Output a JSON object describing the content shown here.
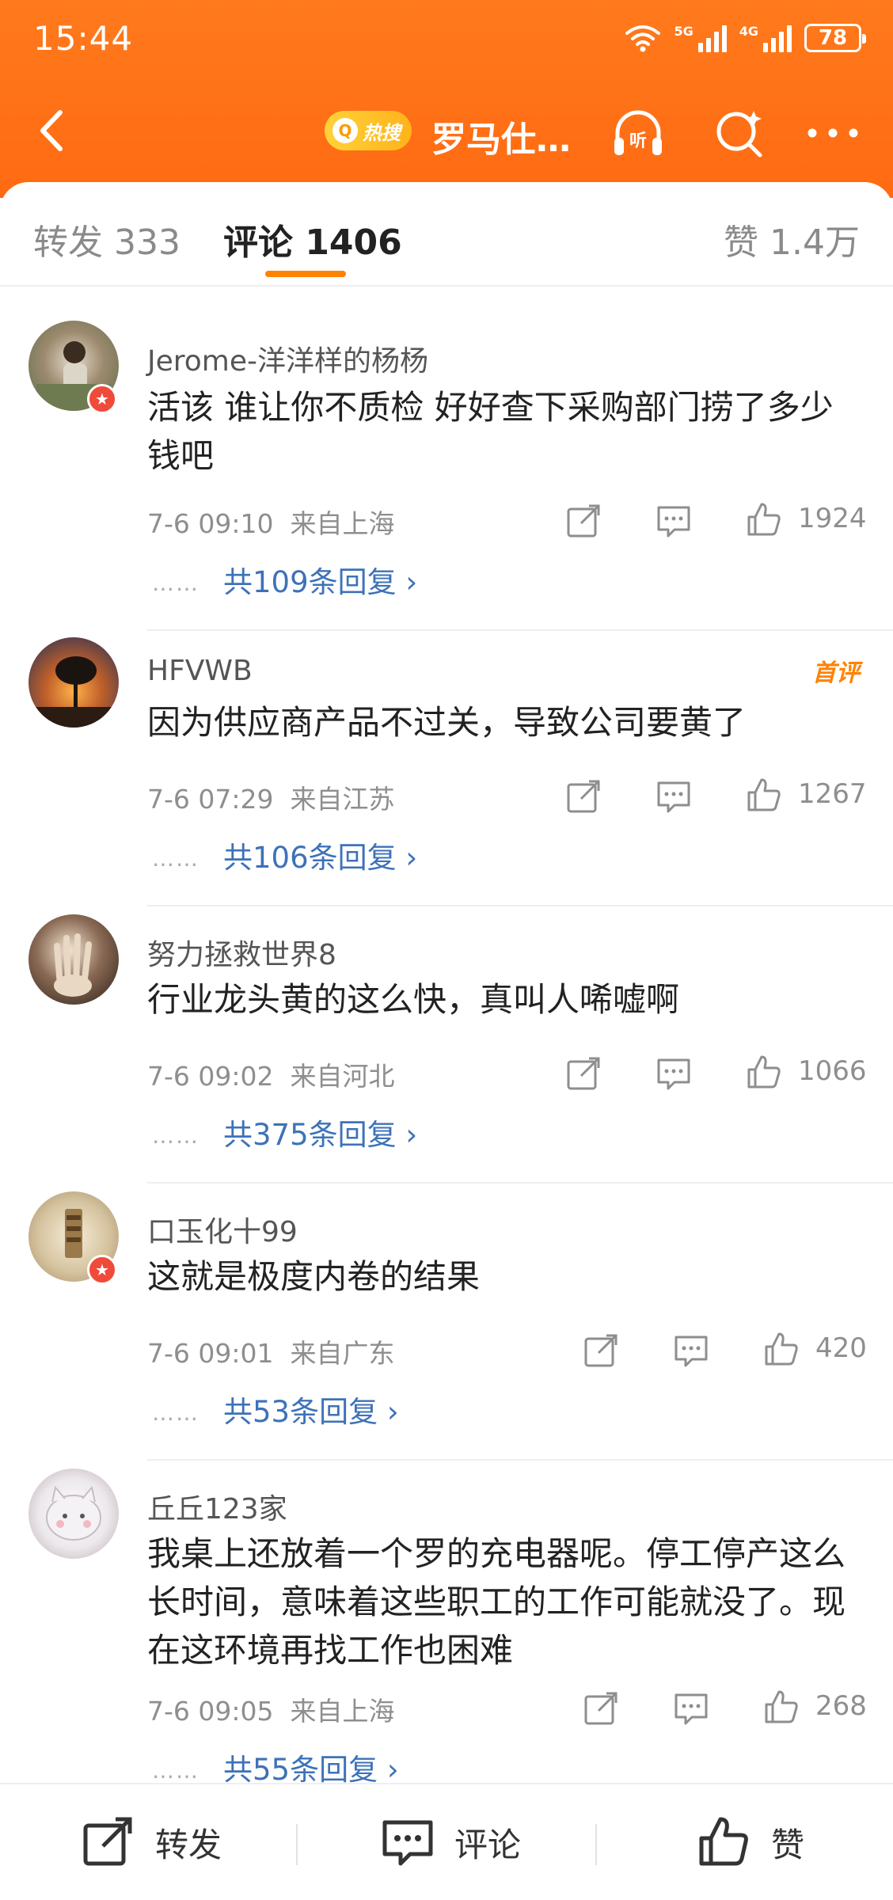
{
  "status_bar": {
    "time": "15:44",
    "net1": "5G",
    "net2": "4G",
    "battery": "78"
  },
  "nav": {
    "hot_label": "热搜",
    "title": "罗马仕…"
  },
  "tabs": {
    "repost": "转发 333",
    "comments": "评论 1406",
    "likes": "赞 1.4万"
  },
  "comments": [
    {
      "user": "Jerome-洋洋样的杨杨",
      "text": "活该 谁让你不质检 好好查下采购部门捞了多少钱吧",
      "time": "7-6 09:10",
      "location": "来自上海",
      "likes": "1924",
      "replies": "共109条回复",
      "dots": "……"
    },
    {
      "user": "HFVWB",
      "badge": "首评",
      "text": "因为供应商产品不过关，导致公司要黄了",
      "time": "7-6 07:29",
      "location": "来自江苏",
      "likes": "1267",
      "replies": "共106条回复",
      "dots": "……"
    },
    {
      "user": "努力拯救世界8",
      "text": "行业龙头黄的这么快，真叫人唏嘘啊",
      "time": "7-6 09:02",
      "location": "来自河北",
      "likes": "1066",
      "replies": "共375条回复",
      "dots": "……"
    },
    {
      "user": "口玉化十99",
      "text": "这就是极度内卷的结果",
      "time": "7-6 09:01",
      "location": "来自广东",
      "likes": "420",
      "replies": "共53条回复",
      "dots": "……"
    },
    {
      "user": "丘丘123家",
      "text": "我桌上还放着一个罗的充电器呢。停工停产这么长时间，意味着这些职工的工作可能就没了。现在这环境再找工作也困难",
      "time": "7-6 09:05",
      "location": "来自上海",
      "likes": "268",
      "replies": "共55条回复",
      "dots": "……"
    }
  ],
  "bottom_bar": {
    "repost": "转发",
    "comment": "评论",
    "like": "赞"
  },
  "colors": {
    "header": "#ff6a12",
    "accent": "#ff8200",
    "link": "#3d72b8"
  }
}
